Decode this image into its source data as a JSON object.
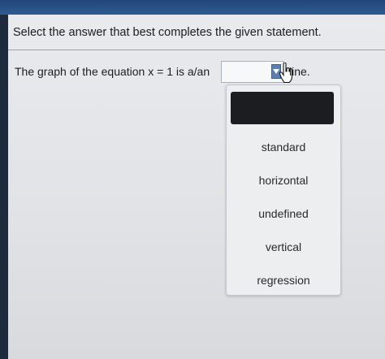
{
  "instruction": "Select the answer that best completes the given statement.",
  "question": {
    "prefix": "The graph of the equation x = 1 is a/an",
    "suffix": "line."
  },
  "dropdown": {
    "selected_value": "",
    "options": [
      "standard",
      "horizontal",
      "undefined",
      "vertical",
      "regression"
    ]
  },
  "colors": {
    "panel": "#e3e5e8",
    "highlight": "#1b1d20",
    "arrow": "#5a7fb0"
  }
}
